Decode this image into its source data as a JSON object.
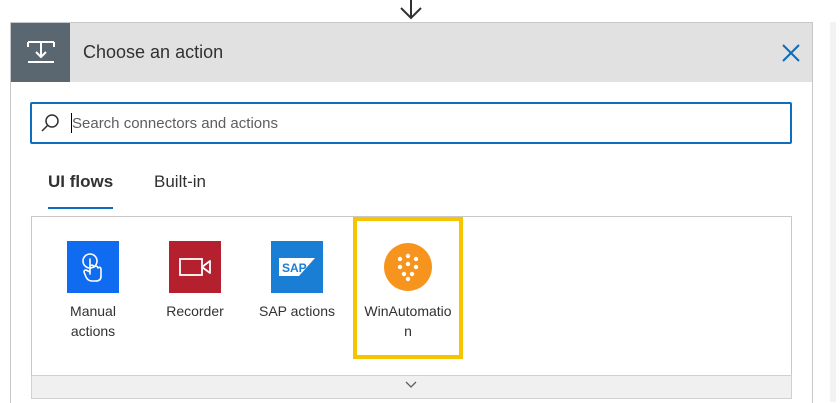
{
  "panel": {
    "title": "Choose an action"
  },
  "search": {
    "placeholder": "Search connectors and actions",
    "value": ""
  },
  "tabs": [
    {
      "label": "UI flows",
      "active": true
    },
    {
      "label": "Built-in",
      "active": false
    }
  ],
  "items": [
    {
      "label": "Manual actions",
      "icon": "touch-icon",
      "color": "#0f6cf0"
    },
    {
      "label": "Recorder",
      "icon": "video-camera-icon",
      "color": "#b4202d"
    },
    {
      "label": "SAP actions",
      "icon": "sap-logo-icon",
      "color": "#1a7ed4"
    },
    {
      "label": "WinAutomation",
      "icon": "winautomation-icon",
      "color": "#f7941d",
      "highlighted": true
    }
  ],
  "colors": {
    "accent": "#0f6cbd",
    "highlight": "#f7c400",
    "header_bg": "#e1e1e1",
    "header_icon_bg": "#5b6770"
  }
}
